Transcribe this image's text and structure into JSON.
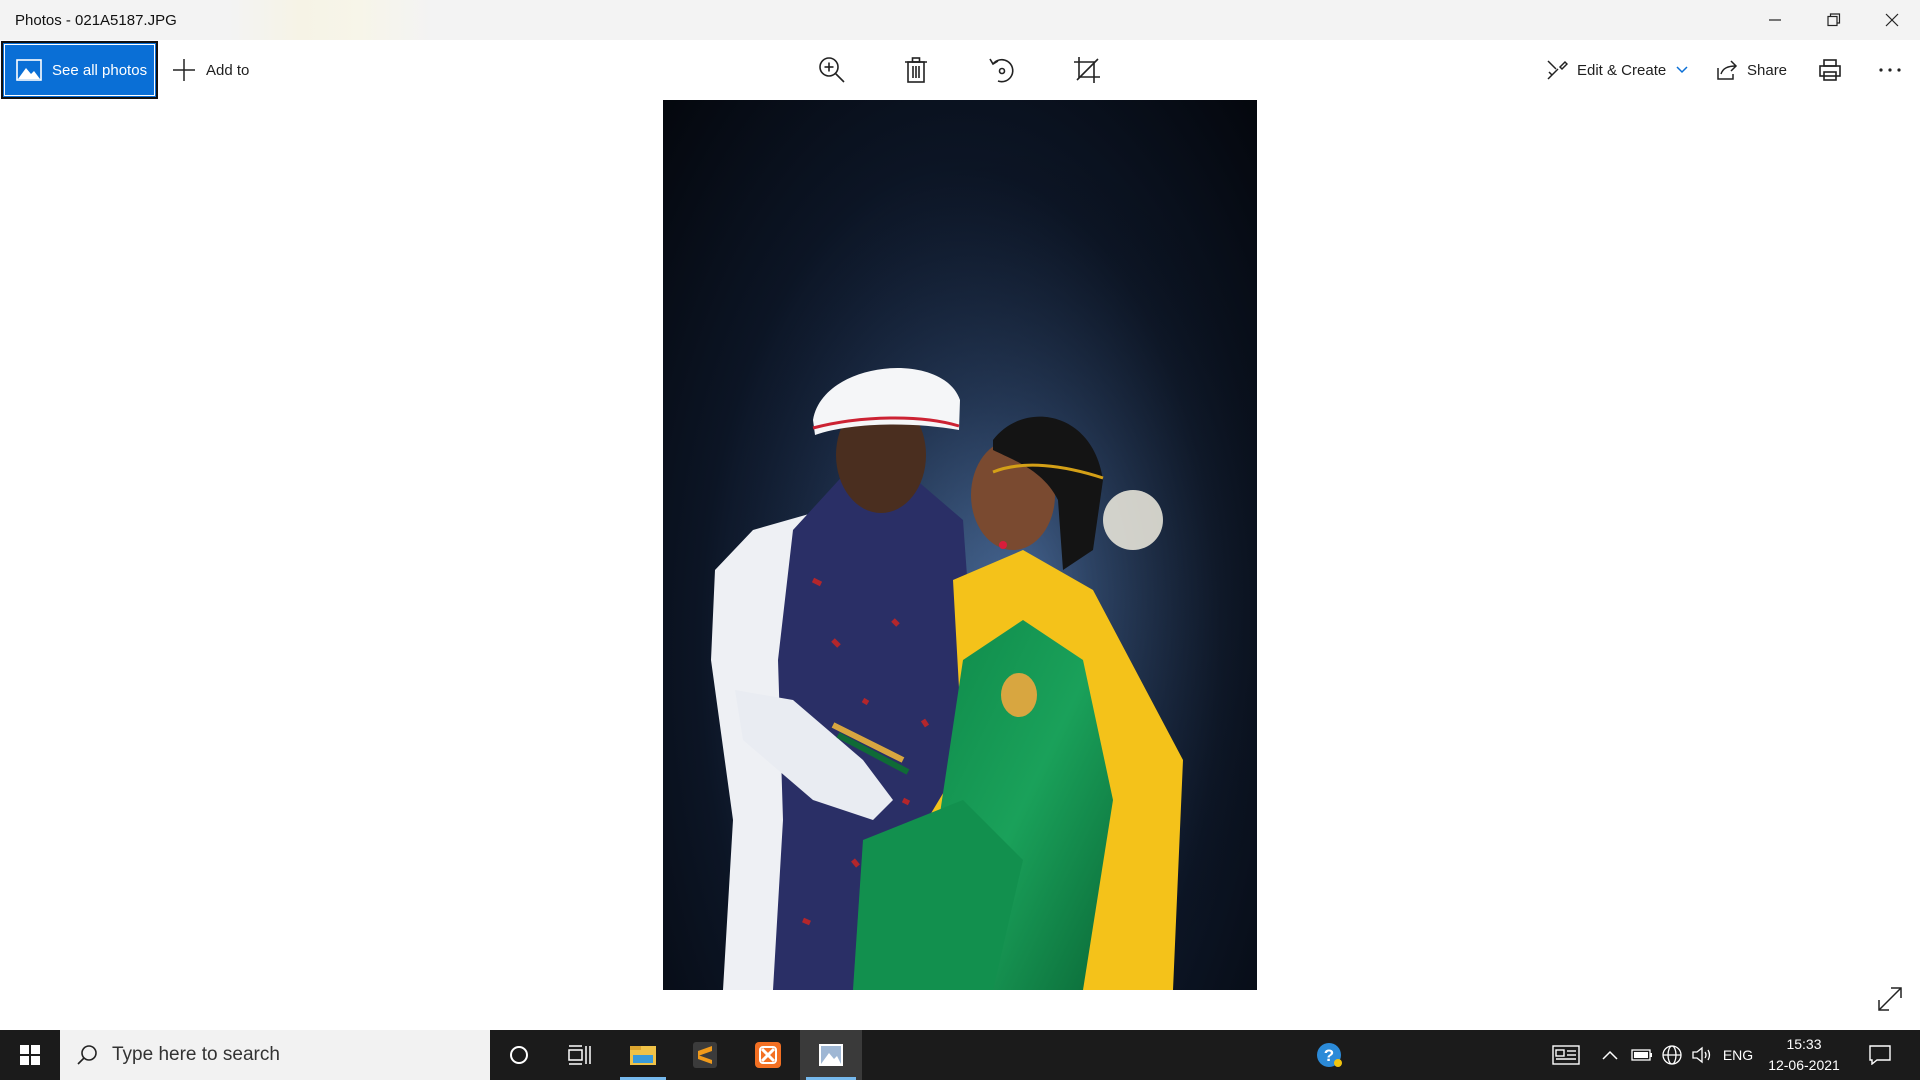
{
  "window": {
    "title": "Photos - 021A5187.JPG",
    "controls": {
      "minimize_icon": "minimize-icon",
      "restore_icon": "restore-icon",
      "close_icon": "close-icon"
    }
  },
  "toolbar": {
    "see_all_photos": "See all photos",
    "add_to": "Add to",
    "tools": [
      "zoom-in-icon",
      "delete-icon",
      "rotate-icon",
      "crop-icon"
    ],
    "edit_create": "Edit & Create",
    "share": "Share",
    "print_icon": "print-icon",
    "more_icon": "more-icon",
    "accent": "#0a6fd6"
  },
  "photo": {
    "subject": "wedding portrait of a couple in traditional Maharashtrian attire"
  },
  "taskbar": {
    "search_placeholder": "Type here to search",
    "apps": [
      "cortana-icon",
      "task-view-icon",
      "file-explorer-icon",
      "sublime-text-icon",
      "xampp-icon",
      "photos-icon"
    ],
    "tray": {
      "language": "ENG",
      "time": "15:33",
      "date": "12-06-2021"
    }
  }
}
